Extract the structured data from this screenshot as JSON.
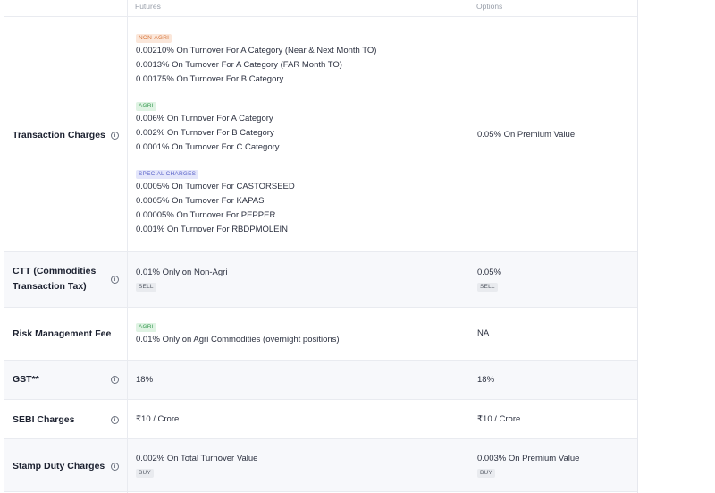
{
  "headers": {
    "futures": "Futures",
    "options": "Options"
  },
  "transaction": {
    "label": "Transaction Charges",
    "groups": [
      {
        "tag": "NON-AGRI",
        "lines": [
          "0.00210% On Turnover For A Category (Near & Next Month TO)",
          "0.0013% On Turnover For A Category (FAR Month TO)",
          "0.00175% On Turnover For B Category"
        ]
      },
      {
        "tag": "AGRI",
        "lines": [
          "0.006% On Turnover For A Category",
          "0.002% On Turnover For B Category",
          "0.0001% On Turnover For C Category"
        ]
      },
      {
        "tag": "SPECIAL CHARGES",
        "lines": [
          "0.0005% On Turnover For CASTORSEED",
          "0.0005% On Turnover For KAPAS",
          "0.00005% On Turnover For PEPPER",
          "0.001% On Turnover For RBDPMOLEIN"
        ]
      }
    ],
    "options": "0.05% On Premium Value"
  },
  "ctt": {
    "label1": "CTT (Commodities",
    "label2": "Transaction Tax)",
    "futures": "0.01% Only on Non-Agri",
    "futures_tag": "SELL",
    "options": "0.05%",
    "options_tag": "SELL"
  },
  "rmf": {
    "label": "Risk Management Fee",
    "futures_tag": "AGRI",
    "futures": "0.01% Only on Agri Commodities (overnight positions)",
    "options": "NA"
  },
  "gst": {
    "label": "GST**",
    "futures": "18%",
    "options": "18%"
  },
  "sebi": {
    "label": "SEBI Charges",
    "futures": "₹10 / Crore",
    "options": "₹10 / Crore"
  },
  "stamp": {
    "label": "Stamp Duty Charges",
    "futures": "0.002% On Total Turnover Value",
    "futures_tag": "BUY",
    "options": "0.003% On Premium Value",
    "options_tag": "BUY"
  },
  "icons": {
    "info": "info-icon",
    "info_glyph": "i"
  }
}
